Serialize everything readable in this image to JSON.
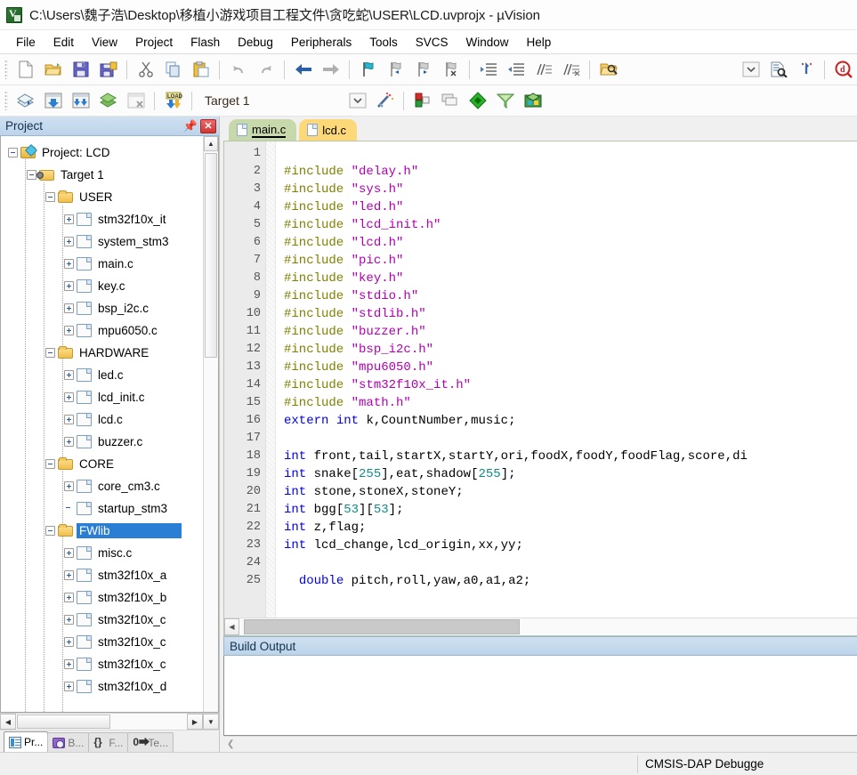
{
  "window": {
    "title": "C:\\Users\\魏子浩\\Desktop\\移植小游戏项目工程文件\\贪吃蛇\\USER\\LCD.uvprojx - µVision",
    "app_icon": "uvision-icon"
  },
  "menubar": {
    "items": [
      {
        "label": "File"
      },
      {
        "label": "Edit"
      },
      {
        "label": "View"
      },
      {
        "label": "Project"
      },
      {
        "label": "Flash"
      },
      {
        "label": "Debug"
      },
      {
        "label": "Peripherals"
      },
      {
        "label": "Tools"
      },
      {
        "label": "SVCS"
      },
      {
        "label": "Window"
      },
      {
        "label": "Help"
      }
    ]
  },
  "toolbar_file": {
    "buttons": [
      {
        "icon": "new-file-icon",
        "label": "New"
      },
      {
        "icon": "open-folder-icon",
        "label": "Open"
      },
      {
        "icon": "save-icon",
        "label": "Save"
      },
      {
        "icon": "save-all-icon",
        "label": "Save All"
      },
      {
        "icon": "cut-icon",
        "label": "Cut"
      },
      {
        "icon": "copy-icon",
        "label": "Copy"
      },
      {
        "icon": "paste-icon",
        "label": "Paste"
      },
      {
        "icon": "undo-icon",
        "label": "Undo"
      },
      {
        "icon": "redo-icon",
        "label": "Redo"
      },
      {
        "icon": "back-arrow-icon",
        "label": "Navigate Backwards"
      },
      {
        "icon": "forward-arrow-icon",
        "label": "Navigate Forwards"
      },
      {
        "icon": "bookmark-toggle-icon",
        "label": "Insert/Remove Bookmark"
      },
      {
        "icon": "bookmark-prev-icon",
        "label": "Previous Bookmark"
      },
      {
        "icon": "bookmark-next-icon",
        "label": "Next Bookmark"
      },
      {
        "icon": "bookmark-clear-icon",
        "label": "Clear All Bookmarks"
      },
      {
        "icon": "indent-right-icon",
        "label": "Indent Selection"
      },
      {
        "icon": "indent-left-icon",
        "label": "Unindent Selection"
      },
      {
        "icon": "comment-icon",
        "label": "Comment Selection"
      },
      {
        "icon": "uncomment-icon",
        "label": "Uncomment Selection"
      },
      {
        "icon": "open-project-icon",
        "label": "Open Project"
      },
      {
        "icon": "dropdown-arrow-icon",
        "label": "Find Combo"
      },
      {
        "icon": "find-in-files-icon",
        "label": "Find in Files"
      },
      {
        "icon": "bookmark-jump-icon",
        "label": "Go To"
      },
      {
        "icon": "debug-search-icon",
        "label": "Start Debug Session"
      }
    ]
  },
  "toolbar_build": {
    "buttons": [
      {
        "icon": "translate-icon",
        "label": "Translate"
      },
      {
        "icon": "build-icon",
        "label": "Build"
      },
      {
        "icon": "rebuild-icon",
        "label": "Rebuild"
      },
      {
        "icon": "batch-build-icon",
        "label": "Batch Build"
      },
      {
        "icon": "stop-build-icon",
        "label": "Stop Build"
      },
      {
        "icon": "download-icon",
        "label": "Download"
      }
    ],
    "target_value": "Target 1",
    "target_dropdown_icon": "dropdown-arrow-icon",
    "after_buttons": [
      {
        "icon": "magic-wand-icon",
        "label": "Configure Target"
      },
      {
        "icon": "target-options-icon",
        "label": "Options for Target"
      },
      {
        "icon": "manage-multi-project-icon",
        "label": "Manage Project Items"
      },
      {
        "icon": "pack-installer-icon",
        "label": "Pack Installer"
      },
      {
        "icon": "run-to-icon",
        "label": "Manage Run-Time Environment"
      },
      {
        "icon": "multi-project-icon",
        "label": "Multi-Project"
      }
    ]
  },
  "project_panel": {
    "title": "Project",
    "pin_icon": "pin-icon",
    "close_icon": "close-icon",
    "tree": [
      {
        "indent": 0,
        "expander": "minus",
        "icon": "project-icon",
        "label": "Project: LCD",
        "selected": false
      },
      {
        "indent": 1,
        "expander": "minus",
        "icon": "target-icon",
        "label": "Target 1",
        "selected": false
      },
      {
        "indent": 2,
        "expander": "minus",
        "icon": "folder-icon",
        "label": "USER",
        "selected": false
      },
      {
        "indent": 3,
        "expander": "plus",
        "icon": "c-file-icon",
        "label": "stm32f10x_it",
        "selected": false
      },
      {
        "indent": 3,
        "expander": "plus",
        "icon": "c-file-icon",
        "label": "system_stm3",
        "selected": false
      },
      {
        "indent": 3,
        "expander": "plus",
        "icon": "c-file-icon",
        "label": "main.c",
        "selected": false
      },
      {
        "indent": 3,
        "expander": "plus",
        "icon": "c-file-icon",
        "label": "key.c",
        "selected": false
      },
      {
        "indent": 3,
        "expander": "plus",
        "icon": "c-file-icon",
        "label": "bsp_i2c.c",
        "selected": false
      },
      {
        "indent": 3,
        "expander": "plus",
        "icon": "c-file-icon",
        "label": "mpu6050.c",
        "selected": false
      },
      {
        "indent": 2,
        "expander": "minus",
        "icon": "folder-icon",
        "label": "HARDWARE",
        "selected": false
      },
      {
        "indent": 3,
        "expander": "plus",
        "icon": "c-file-icon",
        "label": "led.c",
        "selected": false
      },
      {
        "indent": 3,
        "expander": "plus",
        "icon": "c-file-icon",
        "label": "lcd_init.c",
        "selected": false
      },
      {
        "indent": 3,
        "expander": "plus",
        "icon": "c-file-icon",
        "label": "lcd.c",
        "selected": false
      },
      {
        "indent": 3,
        "expander": "plus",
        "icon": "c-file-icon",
        "label": "buzzer.c",
        "selected": false
      },
      {
        "indent": 2,
        "expander": "minus",
        "icon": "folder-icon",
        "label": "CORE",
        "selected": false
      },
      {
        "indent": 3,
        "expander": "plus",
        "icon": "c-file-icon",
        "label": "core_cm3.c",
        "selected": false
      },
      {
        "indent": 3,
        "expander": "none",
        "icon": "c-file-icon",
        "label": "startup_stm3",
        "selected": false
      },
      {
        "indent": 2,
        "expander": "minus",
        "icon": "folder-icon",
        "label": "FWlib",
        "selected": true
      },
      {
        "indent": 3,
        "expander": "plus",
        "icon": "c-file-icon",
        "label": "misc.c",
        "selected": false
      },
      {
        "indent": 3,
        "expander": "plus",
        "icon": "c-file-icon",
        "label": "stm32f10x_a",
        "selected": false
      },
      {
        "indent": 3,
        "expander": "plus",
        "icon": "c-file-icon",
        "label": "stm32f10x_b",
        "selected": false
      },
      {
        "indent": 3,
        "expander": "plus",
        "icon": "c-file-icon",
        "label": "stm32f10x_c",
        "selected": false
      },
      {
        "indent": 3,
        "expander": "plus",
        "icon": "c-file-icon",
        "label": "stm32f10x_c",
        "selected": false
      },
      {
        "indent": 3,
        "expander": "plus",
        "icon": "c-file-icon",
        "label": "stm32f10x_c",
        "selected": false
      },
      {
        "indent": 3,
        "expander": "plus",
        "icon": "c-file-icon",
        "label": "stm32f10x_d",
        "selected": false
      }
    ],
    "scroll_up_icon": "triangle-up-icon",
    "scroll_down_icon": "triangle-down-icon",
    "scroll_left_icon": "triangle-left-icon",
    "scroll_right_icon": "triangle-right-icon"
  },
  "panel_tabs": [
    {
      "label": "Pr...",
      "icon": "project-window-icon",
      "active": true
    },
    {
      "label": "B...",
      "icon": "books-icon",
      "active": false
    },
    {
      "label": "F...",
      "icon": "functions-icon",
      "active": false
    },
    {
      "label": "Te...",
      "icon": "templates-icon",
      "active": false
    }
  ],
  "editor": {
    "tabs": [
      {
        "label": "main.c",
        "active": true,
        "icon": "c-file-icon"
      },
      {
        "label": "lcd.c",
        "active": false,
        "icon": "c-file-icon"
      }
    ],
    "first_line": 1,
    "lines": [
      {
        "n": 1,
        "tokens": []
      },
      {
        "n": 2,
        "tokens": [
          {
            "t": "pre",
            "v": "#include"
          },
          {
            "t": "txt",
            "v": " "
          },
          {
            "t": "str",
            "v": "\"delay.h\""
          }
        ]
      },
      {
        "n": 3,
        "tokens": [
          {
            "t": "pre",
            "v": "#include"
          },
          {
            "t": "txt",
            "v": " "
          },
          {
            "t": "str",
            "v": "\"sys.h\""
          }
        ]
      },
      {
        "n": 4,
        "tokens": [
          {
            "t": "pre",
            "v": "#include"
          },
          {
            "t": "txt",
            "v": " "
          },
          {
            "t": "str",
            "v": "\"led.h\""
          }
        ]
      },
      {
        "n": 5,
        "tokens": [
          {
            "t": "pre",
            "v": "#include"
          },
          {
            "t": "txt",
            "v": " "
          },
          {
            "t": "str",
            "v": "\"lcd_init.h\""
          }
        ]
      },
      {
        "n": 6,
        "tokens": [
          {
            "t": "pre",
            "v": "#include"
          },
          {
            "t": "txt",
            "v": " "
          },
          {
            "t": "str",
            "v": "\"lcd.h\""
          }
        ]
      },
      {
        "n": 7,
        "tokens": [
          {
            "t": "pre",
            "v": "#include"
          },
          {
            "t": "txt",
            "v": " "
          },
          {
            "t": "str",
            "v": "\"pic.h\""
          }
        ]
      },
      {
        "n": 8,
        "tokens": [
          {
            "t": "pre",
            "v": "#include"
          },
          {
            "t": "txt",
            "v": " "
          },
          {
            "t": "str",
            "v": "\"key.h\""
          }
        ]
      },
      {
        "n": 9,
        "tokens": [
          {
            "t": "pre",
            "v": "#include"
          },
          {
            "t": "txt",
            "v": " "
          },
          {
            "t": "str",
            "v": "\"stdio.h\""
          }
        ]
      },
      {
        "n": 10,
        "tokens": [
          {
            "t": "pre",
            "v": "#include"
          },
          {
            "t": "txt",
            "v": " "
          },
          {
            "t": "str",
            "v": "\"stdlib.h\""
          }
        ]
      },
      {
        "n": 11,
        "tokens": [
          {
            "t": "pre",
            "v": "#include"
          },
          {
            "t": "txt",
            "v": " "
          },
          {
            "t": "str",
            "v": "\"buzzer.h\""
          }
        ]
      },
      {
        "n": 12,
        "tokens": [
          {
            "t": "pre",
            "v": "#include"
          },
          {
            "t": "txt",
            "v": " "
          },
          {
            "t": "str",
            "v": "\"bsp_i2c.h\""
          }
        ]
      },
      {
        "n": 13,
        "tokens": [
          {
            "t": "pre",
            "v": "#include"
          },
          {
            "t": "txt",
            "v": " "
          },
          {
            "t": "str",
            "v": "\"mpu6050.h\""
          }
        ]
      },
      {
        "n": 14,
        "tokens": [
          {
            "t": "pre",
            "v": "#include"
          },
          {
            "t": "txt",
            "v": " "
          },
          {
            "t": "str",
            "v": "\"stm32f10x_it.h\""
          }
        ]
      },
      {
        "n": 15,
        "tokens": [
          {
            "t": "pre",
            "v": "#include"
          },
          {
            "t": "txt",
            "v": " "
          },
          {
            "t": "str",
            "v": "\"math.h\""
          }
        ]
      },
      {
        "n": 16,
        "tokens": [
          {
            "t": "kw",
            "v": "extern"
          },
          {
            "t": "txt",
            "v": " "
          },
          {
            "t": "kw",
            "v": "int"
          },
          {
            "t": "txt",
            "v": " k,CountNumber,music;"
          }
        ]
      },
      {
        "n": 17,
        "tokens": []
      },
      {
        "n": 18,
        "tokens": [
          {
            "t": "kw",
            "v": "int"
          },
          {
            "t": "txt",
            "v": " front,tail,startX,startY,ori,foodX,foodY,foodFlag,score,di"
          }
        ]
      },
      {
        "n": 19,
        "tokens": [
          {
            "t": "kw",
            "v": "int"
          },
          {
            "t": "txt",
            "v": " snake["
          },
          {
            "t": "num",
            "v": "255"
          },
          {
            "t": "txt",
            "v": "],eat,shadow["
          },
          {
            "t": "num",
            "v": "255"
          },
          {
            "t": "txt",
            "v": "];"
          }
        ]
      },
      {
        "n": 20,
        "tokens": [
          {
            "t": "kw",
            "v": "int"
          },
          {
            "t": "txt",
            "v": " stone,stoneX,stoneY;"
          }
        ]
      },
      {
        "n": 21,
        "tokens": [
          {
            "t": "kw",
            "v": "int"
          },
          {
            "t": "txt",
            "v": " bgg["
          },
          {
            "t": "num",
            "v": "53"
          },
          {
            "t": "txt",
            "v": "]["
          },
          {
            "t": "num",
            "v": "53"
          },
          {
            "t": "txt",
            "v": "];"
          }
        ]
      },
      {
        "n": 22,
        "tokens": [
          {
            "t": "kw",
            "v": "int"
          },
          {
            "t": "txt",
            "v": " z,flag;"
          }
        ]
      },
      {
        "n": 23,
        "tokens": [
          {
            "t": "kw",
            "v": "int"
          },
          {
            "t": "txt",
            "v": " lcd_change,lcd_origin,xx,yy;"
          }
        ]
      },
      {
        "n": 24,
        "tokens": []
      },
      {
        "n": 25,
        "tokens": [
          {
            "t": "txt",
            "v": "  "
          },
          {
            "t": "kw",
            "v": "double"
          },
          {
            "t": "txt",
            "v": " pitch,roll,yaw,a0,a1,a2;"
          }
        ]
      }
    ]
  },
  "build_output": {
    "title": "Build Output",
    "content": ""
  },
  "statusbar": {
    "right_text": "CMSIS-DAP Debugge"
  },
  "colors": {
    "accent_blue": "#2a7fd4",
    "panel_header": "#bcd4ea",
    "tab_active_green": "#c7d9ab",
    "tab_inactive_amber": "#fcd878",
    "preprocessor": "#808000",
    "string": "#b000b0",
    "keyword": "#0000e0",
    "number": "#0f8a8a",
    "close_red": "#cf3636"
  }
}
